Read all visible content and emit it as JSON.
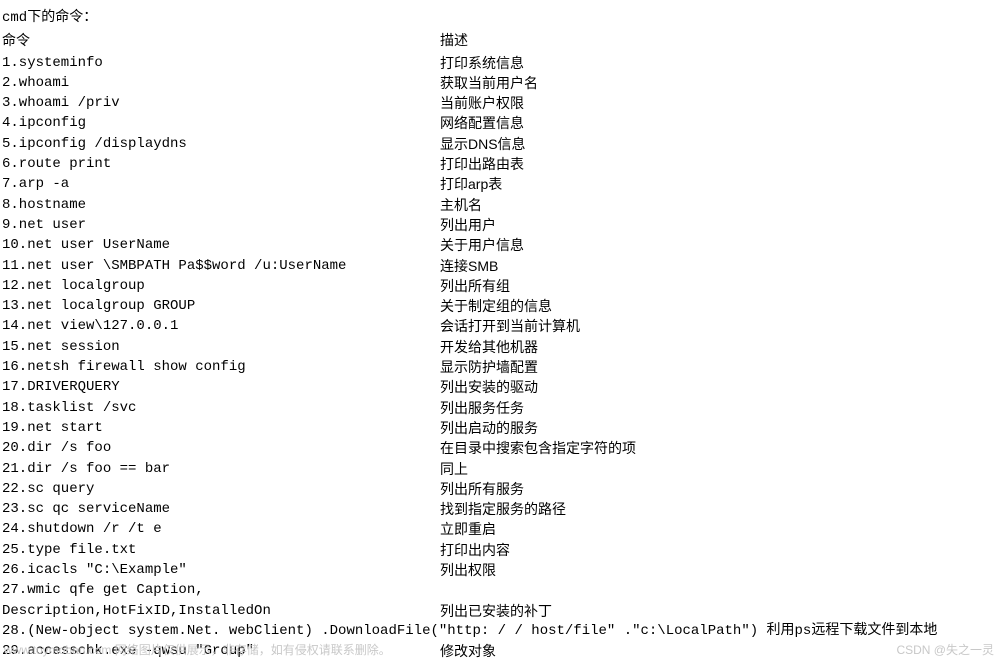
{
  "title": "cmd下的命令：",
  "headers": {
    "cmd": "命令",
    "desc": "描述"
  },
  "rows": [
    {
      "cmd": "1.systeminfo",
      "desc": "打印系统信息"
    },
    {
      "cmd": "2.whoami",
      "desc": "获取当前用户名"
    },
    {
      "cmd": "3.whoami /priv",
      "desc": "当前账户权限"
    },
    {
      "cmd": "4.ipconfig",
      "desc": "网络配置信息"
    },
    {
      "cmd": "5.ipconfig /displaydns",
      "desc": "显示DNS信息"
    },
    {
      "cmd": "6.route print",
      "desc": "打印出路由表"
    },
    {
      "cmd": "7.arp -a",
      "desc": "打印arp表"
    },
    {
      "cmd": "8.hostname",
      "desc": "主机名"
    },
    {
      "cmd": "9.net user",
      "desc": "列出用户"
    },
    {
      "cmd": "10.net user UserName",
      "desc": "关于用户信息"
    },
    {
      "cmd": "11.net user \\SMBPATH Pa$$word /u:UserName",
      "desc": "连接SMB"
    },
    {
      "cmd": "12.net localgroup",
      "desc": "列出所有组"
    },
    {
      "cmd": "13.net localgroup GROUP",
      "desc": "关于制定组的信息"
    },
    {
      "cmd": "14.net view\\127.0.0.1",
      "desc": "会话打开到当前计算机"
    },
    {
      "cmd": "15.net session",
      "desc": "开发给其他机器"
    },
    {
      "cmd": "16.netsh firewall show config",
      "desc": "显示防护墙配置"
    },
    {
      "cmd": "17.DRIVERQUERY",
      "desc": "列出安装的驱动"
    },
    {
      "cmd": "18.tasklist /svc",
      "desc": "列出服务任务"
    },
    {
      "cmd": "19.net start",
      "desc": "列出启动的服务"
    },
    {
      "cmd": "20.dir /s foo",
      "desc": "在目录中搜索包含指定字符的项"
    },
    {
      "cmd": "21.dir /s foo == bar",
      "desc": "同上"
    },
    {
      "cmd": "22.sc query",
      "desc": "列出所有服务"
    },
    {
      "cmd": "23.sc qc serviceName",
      "desc": "找到指定服务的路径"
    },
    {
      "cmd": "24.shutdown /r /t e",
      "desc": "立即重启"
    },
    {
      "cmd": "25.type file.txt",
      "desc": "打印出内容"
    },
    {
      "cmd": "26.icacls \"C:\\Example\"",
      "desc": "列出权限"
    }
  ],
  "row27": {
    "line1": "27.wmic qfe get Caption,",
    "line2_cmd": "Description,HotFixID,InstalledOn",
    "line2_desc": "列出已安装的补丁"
  },
  "row28": "28.(New-object system.Net. webClient) .DownloadFile(\"http: / / host/file\" .\"c:\\LocalPath\") 利用ps远程下载文件到本地",
  "row29": {
    "cmd": "29.accesschk.exe -qwsu \"Group\"",
    "desc": "修改对象"
  },
  "watermark_bl": "www.toymoban.com 网络图片仅供展示，非存储，如有侵权请联系删除。",
  "watermark_br": "CSDN @失之一灵"
}
